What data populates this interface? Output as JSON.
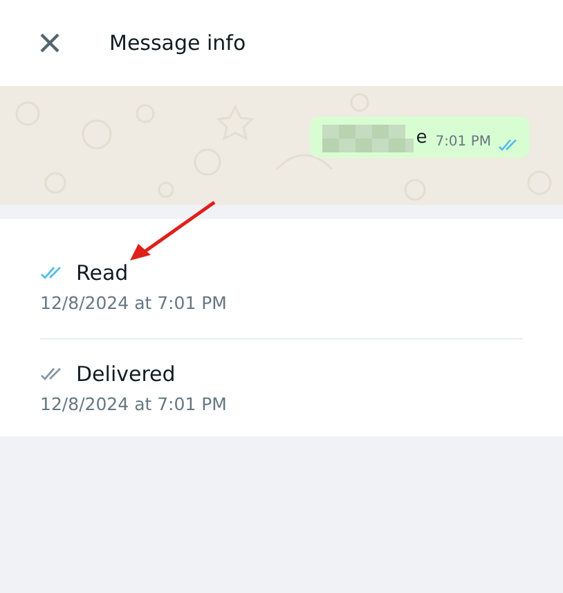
{
  "header": {
    "title": "Message info"
  },
  "message": {
    "text_tail": "e",
    "time": "7:01 PM",
    "read": true
  },
  "statuses": [
    {
      "label": "Read",
      "time": "12/8/2024 at 7:01 PM",
      "read": true
    },
    {
      "label": "Delivered",
      "time": "12/8/2024 at 7:01 PM",
      "read": false
    }
  ]
}
